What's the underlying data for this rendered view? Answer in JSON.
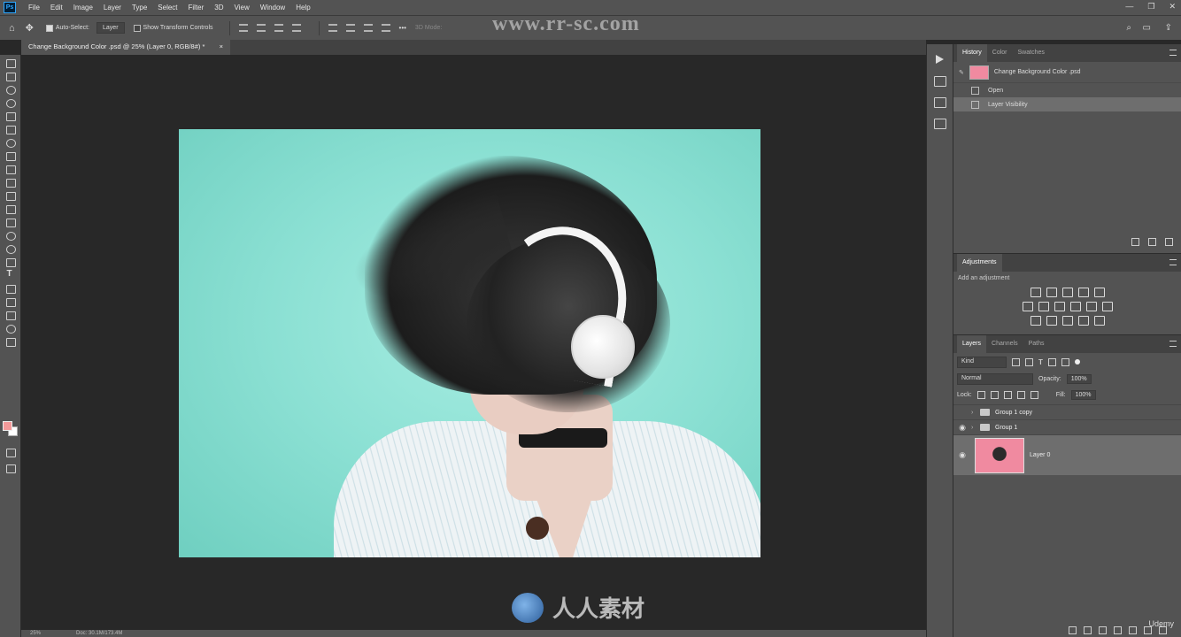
{
  "menubar": {
    "logo": "Ps",
    "items": [
      "File",
      "Edit",
      "Image",
      "Layer",
      "Type",
      "Select",
      "Filter",
      "3D",
      "View",
      "Window",
      "Help"
    ],
    "window_controls": [
      "—",
      "❐",
      "✕"
    ]
  },
  "options": {
    "auto_select_label": "Auto-Select:",
    "auto_select_target": "Layer",
    "transform_label": "Show Transform Controls",
    "mode_3d": "3D Mode:"
  },
  "document": {
    "tab_title": "Change Background Color .psd @ 25% (Layer 0, RGB/8#) *",
    "close_glyph": "×"
  },
  "statusbar": {
    "zoom": "25%",
    "doc_size": "Doc: 30.1M/173.4M"
  },
  "history": {
    "tabs": [
      "History",
      "Color",
      "Swatches"
    ],
    "snapshot": "Change Background Color .psd",
    "states": [
      {
        "label": "Open",
        "selected": false
      },
      {
        "label": "Layer Visibility",
        "selected": true
      }
    ]
  },
  "adjustments": {
    "title": "Adjustments",
    "hint": "Add an adjustment"
  },
  "layers": {
    "tabs": [
      "Layers",
      "Channels",
      "Paths"
    ],
    "filter": "Kind",
    "blend_mode": "Normal",
    "opacity_label": "Opacity:",
    "opacity": "100%",
    "lock_label": "Lock:",
    "fill_label": "Fill:",
    "fill": "100%",
    "items": [
      {
        "name": "Group 1 copy",
        "type": "group",
        "visible": false
      },
      {
        "name": "Group 1",
        "type": "group",
        "visible": true
      },
      {
        "name": "Layer 0",
        "type": "image",
        "visible": true,
        "selected": true
      }
    ]
  },
  "watermarks": {
    "url": "www.rr-sc.com",
    "brand": "人人素材",
    "udemy": "Udemy"
  },
  "colors": {
    "foreground": "#f49a9a",
    "background": "#ffffff",
    "canvas_bg": "#8be0d3"
  }
}
